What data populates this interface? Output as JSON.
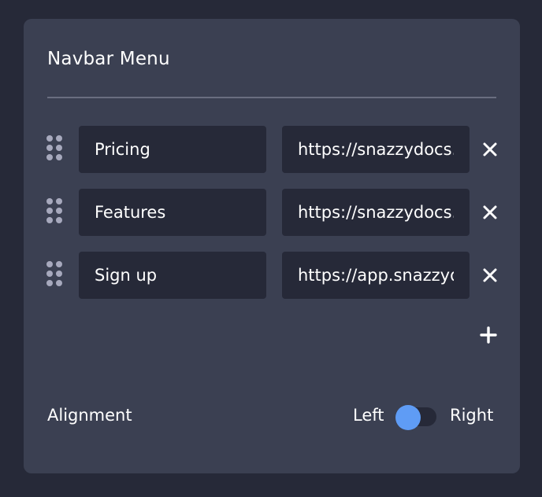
{
  "panel": {
    "title": "Navbar Menu"
  },
  "menu_items": [
    {
      "label": "Pricing",
      "url": "https://snazzydocs.com/pricing"
    },
    {
      "label": "Features",
      "url": "https://snazzydocs.com/features"
    },
    {
      "label": "Sign up",
      "url": "https://app.snazzydocs.com/signup"
    }
  ],
  "icons": {
    "drag": "drag-handle-icon",
    "remove": "close-icon",
    "add": "plus-icon"
  },
  "alignment": {
    "label": "Alignment",
    "left_label": "Left",
    "right_label": "Right",
    "selected": "Left"
  },
  "colors": {
    "background": "#262938",
    "panel": "#3b4052",
    "input": "#262938",
    "accent": "#5f9cf5",
    "handle": "#a7a9bd"
  }
}
